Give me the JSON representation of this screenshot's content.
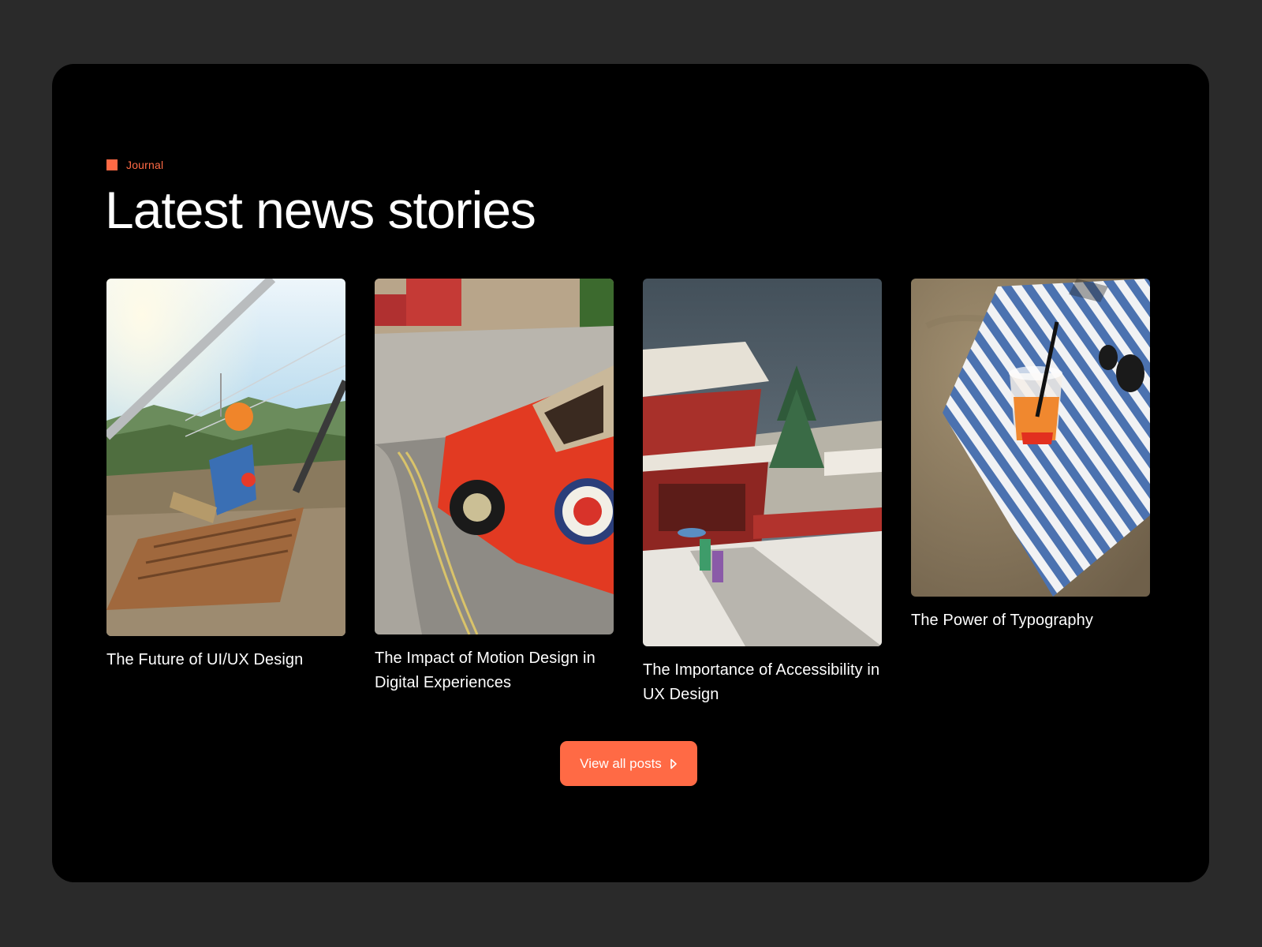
{
  "section": {
    "eyebrow": "Journal",
    "title": "Latest news stories"
  },
  "posts": [
    {
      "title": "The Future of UI/UX Design",
      "image": "zipline-mountain-photo"
    },
    {
      "title": "The Impact of Motion Design in Digital Experiences",
      "image": "red-mini-car-photo"
    },
    {
      "title": "The Importance of Accessibility in UX Design",
      "image": "snowy-temple-painting"
    },
    {
      "title": "The Power of Typography",
      "image": "beach-towel-drink-photo"
    }
  ],
  "cta": {
    "label": "View all posts",
    "icon": "caret-right-icon"
  },
  "colors": {
    "accent": "#ff6a45",
    "panel": "#000000",
    "background": "#2a2a2a"
  }
}
